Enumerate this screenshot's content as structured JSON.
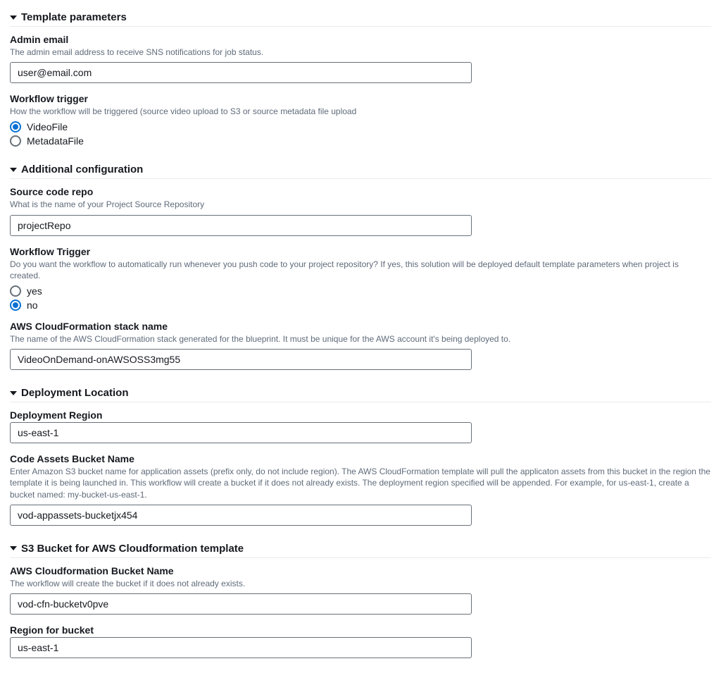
{
  "sections": {
    "template": {
      "title": "Template parameters",
      "adminEmail": {
        "label": "Admin email",
        "desc": "The admin email address to receive SNS notifications for job status.",
        "value": "user@email.com"
      },
      "workflowTrigger": {
        "label": "Workflow trigger",
        "desc": "How the workflow will be triggered (source video upload to S3 or source metadata file upload",
        "options": [
          "VideoFile",
          "MetadataFile"
        ],
        "selected": "VideoFile"
      }
    },
    "additional": {
      "title": "Additional configuration",
      "sourceRepo": {
        "label": "Source code repo",
        "desc": "What is the name of your Project Source Repository",
        "value": "projectRepo"
      },
      "workflowTrigger2": {
        "label": "Workflow Trigger",
        "desc": "Do you want the workflow to automatically run whenever you push code to your project repository? If yes, this solution will be deployed default template parameters when project is created.",
        "options": [
          "yes",
          "no"
        ],
        "selected": "no"
      },
      "stackName": {
        "label": "AWS CloudFormation stack name",
        "desc": "The name of the AWS CloudFormation stack generated for the blueprint. It must be unique for the AWS account it's being deployed to.",
        "value": "VideoOnDemand-onAWSOSS3mg55"
      }
    },
    "deploy": {
      "title": "Deployment Location",
      "region": {
        "label": "Deployment Region",
        "value": "us-east-1"
      },
      "bucket": {
        "label": "Code Assets Bucket Name",
        "desc": "Enter Amazon S3 bucket name for application assets (prefix only, do not include region). The AWS CloudFormation template will pull the applicaton assets from this bucket in the region the template it is being launched in. This workflow will create a bucket if it does not already exists. The deployment region specified will be appended. For example, for us-east-1, create a bucket named: my-bucket-us-east-1.",
        "value": "vod-appassets-bucketjx454"
      }
    },
    "s3": {
      "title": "S3 Bucket for AWS Cloudformation template",
      "cfnBucket": {
        "label": "AWS Cloudformation Bucket Name",
        "desc": "The workflow will create the bucket if it does not already exists.",
        "value": "vod-cfn-bucketv0pve"
      },
      "bucketRegion": {
        "label": "Region for bucket",
        "value": "us-east-1"
      }
    }
  }
}
